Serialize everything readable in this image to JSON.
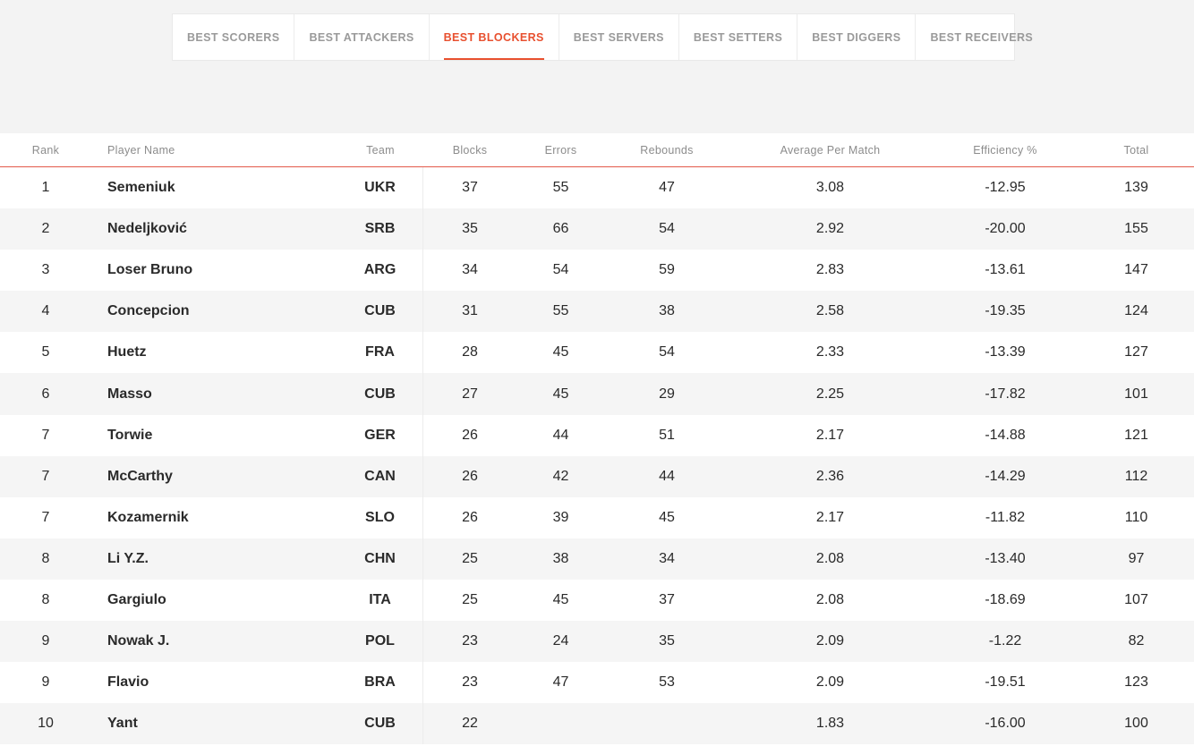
{
  "tabs": [
    {
      "label": "BEST SCORERS",
      "active": false
    },
    {
      "label": "BEST ATTACKERS",
      "active": false
    },
    {
      "label": "BEST BLOCKERS",
      "active": true
    },
    {
      "label": "BEST SERVERS",
      "active": false
    },
    {
      "label": "BEST SETTERS",
      "active": false
    },
    {
      "label": "BEST DIGGERS",
      "active": false
    },
    {
      "label": "BEST RECEIVERS",
      "active": false
    }
  ],
  "colors": {
    "accent": "#e8502f",
    "header_rule": "#e35a4a",
    "page_bg": "#f3f3f3"
  },
  "table": {
    "headers": {
      "rank": "Rank",
      "name": "Player Name",
      "team": "Team",
      "blocks": "Blocks",
      "errors": "Errors",
      "rebounds": "Rebounds",
      "avg": "Average Per Match",
      "eff": "Efficiency %",
      "total": "Total"
    },
    "rows": [
      {
        "rank": "1",
        "name": "Semeniuk",
        "team": "UKR",
        "blocks": "37",
        "errors": "55",
        "rebounds": "47",
        "avg": "3.08",
        "eff": "-12.95",
        "total": "139"
      },
      {
        "rank": "2",
        "name": "Nedeljković",
        "team": "SRB",
        "blocks": "35",
        "errors": "66",
        "rebounds": "54",
        "avg": "2.92",
        "eff": "-20.00",
        "total": "155"
      },
      {
        "rank": "3",
        "name": "Loser Bruno",
        "team": "ARG",
        "blocks": "34",
        "errors": "54",
        "rebounds": "59",
        "avg": "2.83",
        "eff": "-13.61",
        "total": "147"
      },
      {
        "rank": "4",
        "name": "Concepcion",
        "team": "CUB",
        "blocks": "31",
        "errors": "55",
        "rebounds": "38",
        "avg": "2.58",
        "eff": "-19.35",
        "total": "124"
      },
      {
        "rank": "5",
        "name": "Huetz",
        "team": "FRA",
        "blocks": "28",
        "errors": "45",
        "rebounds": "54",
        "avg": "2.33",
        "eff": "-13.39",
        "total": "127"
      },
      {
        "rank": "6",
        "name": "Masso",
        "team": "CUB",
        "blocks": "27",
        "errors": "45",
        "rebounds": "29",
        "avg": "2.25",
        "eff": "-17.82",
        "total": "101"
      },
      {
        "rank": "7",
        "name": "Torwie",
        "team": "GER",
        "blocks": "26",
        "errors": "44",
        "rebounds": "51",
        "avg": "2.17",
        "eff": "-14.88",
        "total": "121"
      },
      {
        "rank": "7",
        "name": "McCarthy",
        "team": "CAN",
        "blocks": "26",
        "errors": "42",
        "rebounds": "44",
        "avg": "2.36",
        "eff": "-14.29",
        "total": "112"
      },
      {
        "rank": "7",
        "name": "Kozamernik",
        "team": "SLO",
        "blocks": "26",
        "errors": "39",
        "rebounds": "45",
        "avg": "2.17",
        "eff": "-11.82",
        "total": "110"
      },
      {
        "rank": "8",
        "name": "Li Y.Z.",
        "team": "CHN",
        "blocks": "25",
        "errors": "38",
        "rebounds": "34",
        "avg": "2.08",
        "eff": "-13.40",
        "total": "97"
      },
      {
        "rank": "8",
        "name": "Gargiulo",
        "team": "ITA",
        "blocks": "25",
        "errors": "45",
        "rebounds": "37",
        "avg": "2.08",
        "eff": "-18.69",
        "total": "107"
      },
      {
        "rank": "9",
        "name": "Nowak J.",
        "team": "POL",
        "blocks": "23",
        "errors": "24",
        "rebounds": "35",
        "avg": "2.09",
        "eff": "-1.22",
        "total": "82"
      },
      {
        "rank": "9",
        "name": "Flavio",
        "team": "BRA",
        "blocks": "23",
        "errors": "47",
        "rebounds": "53",
        "avg": "2.09",
        "eff": "-19.51",
        "total": "123"
      },
      {
        "rank": "10",
        "name": "Yant",
        "team": "CUB",
        "blocks": "22",
        "errors": "",
        "rebounds": "",
        "avg": "1.83",
        "eff": "-16.00",
        "total": "100"
      }
    ]
  }
}
